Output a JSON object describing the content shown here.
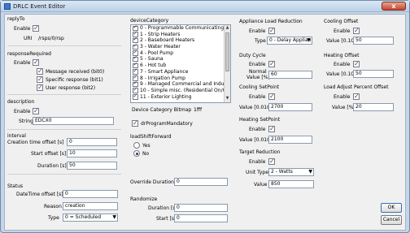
{
  "window": {
    "title": "DRLC Event Editor",
    "close_label": "x"
  },
  "replyTo": {
    "heading": "replyTo",
    "enable_label": "Enable",
    "enable_checked": true,
    "uri_label": "URI",
    "uri_value": "/rsps/0/rsp"
  },
  "responseRequired": {
    "heading": "responseRequired",
    "enable_label": "Enable",
    "options": [
      {
        "label": "Message received (bit0)",
        "checked": true
      },
      {
        "label": "Specific response (bit1)",
        "checked": true
      },
      {
        "label": "User response (bit2)",
        "checked": true
      }
    ]
  },
  "description": {
    "heading": "description",
    "enable_label": "Enable",
    "string_label": "String",
    "string_value": "EDCX0"
  },
  "interval": {
    "heading": "interval",
    "creation_label": "Creation time offset [s]",
    "creation_value": "0",
    "start_label": "Start offset [s]",
    "start_value": "10",
    "duration_label": "Duration [s]",
    "duration_value": "50"
  },
  "status": {
    "heading": "Status",
    "datetime_label": "DateTime offset [s]",
    "datetime_value": "0",
    "reason_label": "Reason",
    "reason_value": "creation",
    "type_label": "Type",
    "type_value": "0 = Scheduled"
  },
  "deviceCategory": {
    "heading": "deviceCategory",
    "items": [
      "0 - Programmable Communicating",
      "1 - Strip Heaters",
      "2 - Baseboard Heaters",
      "3 - Water Heater",
      "4 - Pool Pump",
      "5 - Sauna",
      "6 - Hot tub",
      "7 - Smart Appliance",
      "8 - Irrigation Pump",
      "9 - Managed Commercial and Indu",
      "10 - Simple misc. (Residential On/C",
      "11 - Exterior Lighting"
    ],
    "bitmap_label": "Device Category Bitmap",
    "bitmap_value": "1fff"
  },
  "drProgramMandatory": {
    "label": "drProgramMandatory",
    "checked": true
  },
  "loadShiftForward": {
    "heading": "loadShiftForward",
    "options": [
      {
        "label": "Yes",
        "selected": false
      },
      {
        "label": "No",
        "selected": true
      }
    ]
  },
  "overrideDuration": {
    "label": "Override Duration [s]",
    "value": "0"
  },
  "randomize": {
    "heading": "Randomize",
    "duration_label": "Duration [s]",
    "duration_value": "0",
    "start_label": "Start [s]",
    "start_value": "0"
  },
  "applianceLoadReduction": {
    "heading": "Appliance Load Reduction",
    "enable_label": "Enable",
    "type_label": "Type",
    "type_value": "0 - Delay Applian"
  },
  "dutyCycle": {
    "heading": "Duty Cycle",
    "enable_label": "Enable",
    "normal_label_1": "Normal",
    "normal_label_2": "Value [%]",
    "normal_value": "60"
  },
  "coolingSetPoint": {
    "heading": "Cooling SetPoint",
    "enable_label": "Enable",
    "value_label": "Value [0.01C]",
    "value": "2700"
  },
  "heatingSetPoint": {
    "heading": "Heating SetPoint",
    "enable_label": "Enable",
    "value_label": "Value [0.01C]",
    "value": "2100"
  },
  "targetReduction": {
    "heading": "Target Reduction",
    "enable_label": "Enable",
    "unit_label": "Unit Type",
    "unit_value": "2 - Watts",
    "value_label": "Value",
    "value": "850"
  },
  "coolingOffset": {
    "heading": "Cooling Offset",
    "enable_label": "Enable",
    "value_label": "Value [0.1C]",
    "value": "50"
  },
  "heatingOffset": {
    "heading": "Heating Offset",
    "enable_label": "Enable",
    "value_label": "Value [0.1C]",
    "value": "50"
  },
  "loadAdjust": {
    "heading": "Load Adjust Percent Offset",
    "enable_label": "Enable",
    "value_label": "Value [%]",
    "value": "20"
  },
  "buttons": {
    "ok": "OK",
    "cancel": "Cancel"
  }
}
